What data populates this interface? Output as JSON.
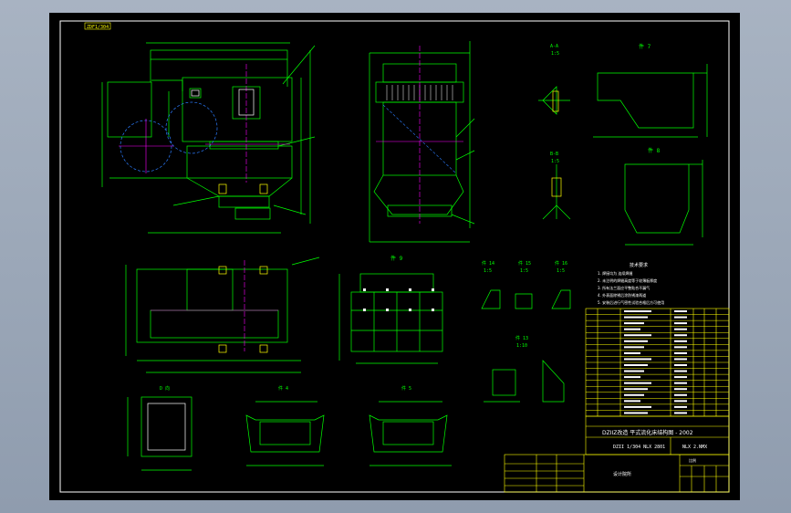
{
  "drawing": {
    "tag_label": "ZDF1/304",
    "title_block": {
      "title_main": "DZIIZ改造  平式流化床结构图 - 2002",
      "code": "DZII 1/304 NLX 2801",
      "sheet_no": "NLX 2.NMX",
      "scale_label": "比例",
      "company": "设计院所"
    },
    "notes": {
      "title": "技术要求",
      "lines": [
        "1. 焊接均为 连续焊缝",
        "2. 未注明的焊缝高度等于较薄板厚度",
        "3. 所有法兰面应平整贴合不漏气",
        "4. 外表面除锈后涂防锈漆两道",
        "5. 安装后进行气密性试验合格后方可使用"
      ]
    },
    "view_labels": {
      "section_aa": "A-A",
      "section_aa_scale": "1:5",
      "section_bb": "B-B",
      "section_bb_scale": "1:5",
      "part7": "件 7",
      "part8": "件 8",
      "part9": "件 9",
      "part10_scale": "1:10",
      "part13": "件 13",
      "part14": "件 14",
      "part15": "件 15",
      "part16": "件 16",
      "part_scale": "1:5",
      "view_c": "C 向",
      "view_d": "D 向",
      "part4": "件 4",
      "part5": "件 5",
      "part3": "件 3"
    },
    "bom_rows": 18,
    "colors": {
      "frame": "#ffffff",
      "line": "#00ff00",
      "center": "#ff00ff",
      "table": "#ffff00",
      "hidden": "#2b7cff",
      "bg": "#000000"
    }
  }
}
